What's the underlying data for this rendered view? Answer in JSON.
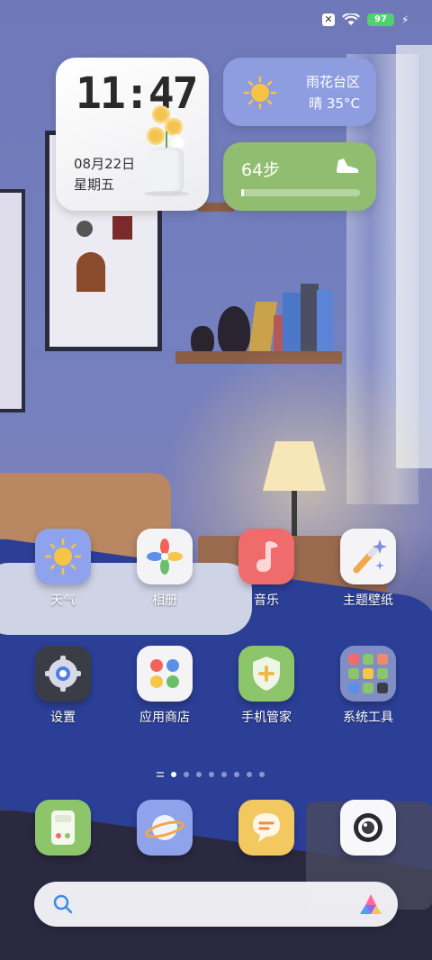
{
  "status_bar": {
    "notification_icon": "close-square-icon",
    "wifi_icon": "wifi-icon",
    "battery_level": "97",
    "battery_color": "#4fd170",
    "charging_icon": "charging-plug-icon"
  },
  "clock_widget": {
    "time": "11:47",
    "date": "08月22日",
    "weekday": "星期五"
  },
  "weather_widget": {
    "city": "雨花台区",
    "condition": "晴 35°C",
    "icon": "sun-icon",
    "color": "#8d9de0"
  },
  "steps_widget": {
    "value": "64步",
    "icon": "shoe-icon",
    "color": "#90bd6f",
    "progress": 0.02
  },
  "apps_row1": [
    {
      "label": "天气",
      "icon": "weather-sun-icon"
    },
    {
      "label": "相册",
      "icon": "gallery-flower-icon"
    },
    {
      "label": "音乐",
      "icon": "music-note-icon"
    },
    {
      "label": "主题壁纸",
      "icon": "theme-wand-icon"
    }
  ],
  "apps_row2": [
    {
      "label": "设置",
      "icon": "settings-gear-icon"
    },
    {
      "label": "应用商店",
      "icon": "app-store-dots-icon"
    },
    {
      "label": "手机管家",
      "icon": "security-shield-icon"
    },
    {
      "label": "系统工具",
      "icon": "system-tools-folder-icon"
    }
  ],
  "page_indicator": {
    "total_pages": 8,
    "active_page": 1
  },
  "dock": [
    {
      "name": "phone-dialer",
      "icon": "phone-keypad-icon"
    },
    {
      "name": "browser",
      "icon": "planet-browser-icon"
    },
    {
      "name": "messages",
      "icon": "chat-bubble-icon"
    },
    {
      "name": "camera",
      "icon": "camera-lens-icon"
    }
  ],
  "search_bar": {
    "search_icon": "search-icon",
    "assistant_icon": "assistant-logo-icon"
  }
}
